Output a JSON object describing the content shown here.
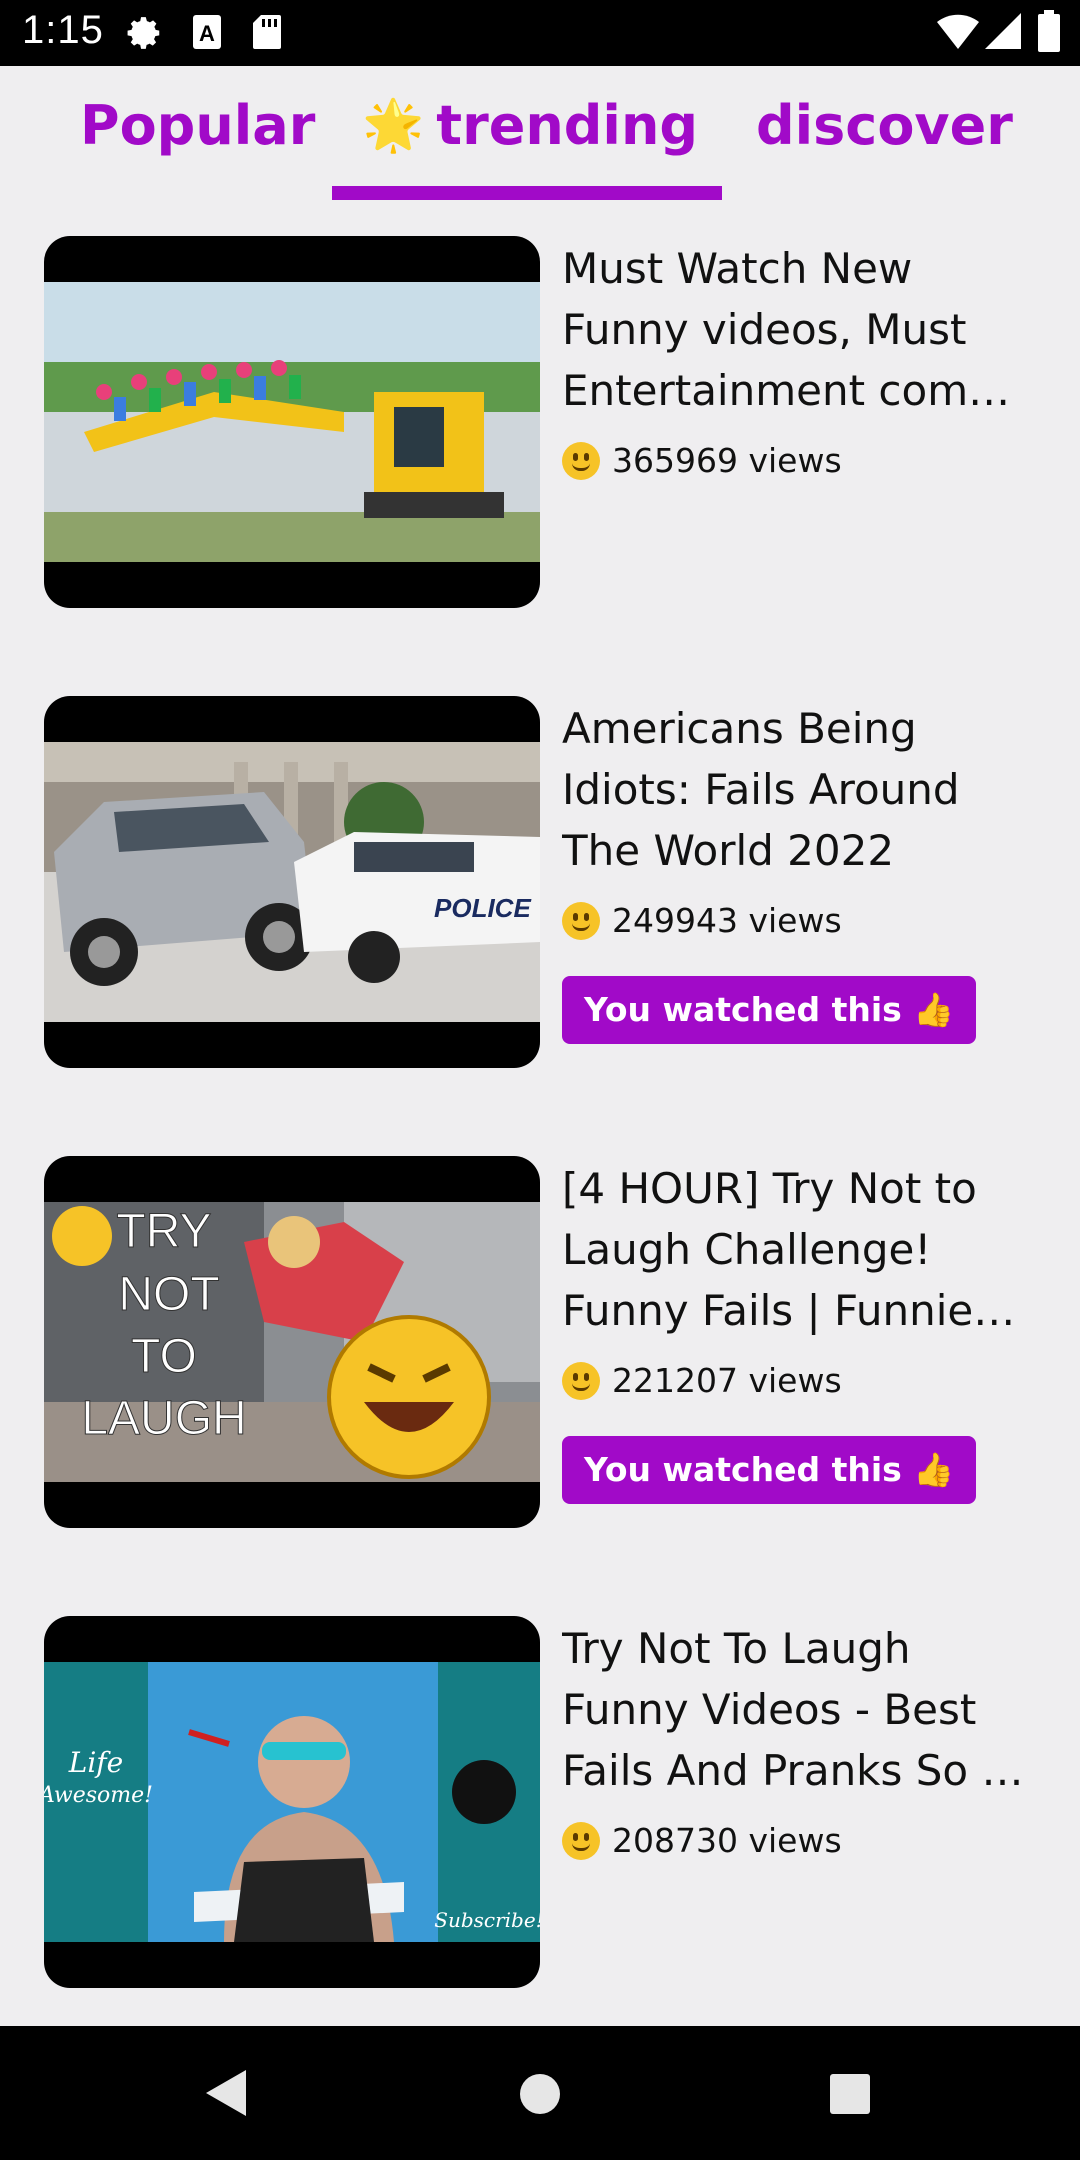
{
  "status_bar": {
    "time": "1:15",
    "icons": [
      "gear-icon",
      "a-icon",
      "sd-card-icon",
      "wifi-icon",
      "signal-icon",
      "battery-icon"
    ]
  },
  "tabs": {
    "items": [
      {
        "label": "Popular"
      },
      {
        "icon": "🌟",
        "label": "trending"
      },
      {
        "label": "discover"
      }
    ],
    "selected": "trending"
  },
  "colors": {
    "accent": "#a10ac8",
    "background": "#efeef0"
  },
  "videos": [
    {
      "title": "Must Watch New Funny videos, Must Entertainment com…",
      "views": "365969 views",
      "watched": false,
      "thumbnail": "excavator-people-thumbnail"
    },
    {
      "title": "Americans Being Idiots: Fails Around The World 2022",
      "views": "249943 views",
      "watched": true,
      "watched_label": "You watched this 👍",
      "thumbnail": "car-police-crash-thumbnail"
    },
    {
      "title": "[4 HOUR] Try Not to Laugh Challenge! Funny Fails | Funnie…",
      "views": "221207 views",
      "watched": true,
      "watched_label": "You watched this 👍",
      "thumbnail": "try-not-to-laugh-thumbnail",
      "thumbnail_text": [
        "TRY",
        "NOT",
        "TO",
        "LAUGH"
      ]
    },
    {
      "title": "Try Not To Laugh Funny Videos - Best Fails And Pranks So …",
      "views": "208730 views",
      "watched": false,
      "thumbnail": "pool-woman-thumbnail",
      "thumbnail_text": [
        "Life",
        "Awesome!",
        "Subscribe!"
      ]
    }
  ],
  "nav_bar": {
    "icons": [
      "back-icon",
      "home-icon",
      "recents-icon"
    ]
  }
}
